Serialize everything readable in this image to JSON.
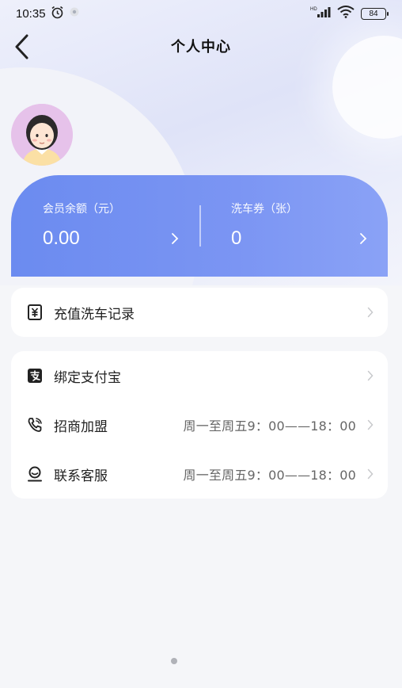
{
  "status_bar": {
    "time": "10:35",
    "battery": "84",
    "network": "HD"
  },
  "header": {
    "title": "个人中心"
  },
  "balance_card": {
    "left_label": "会员余额（元）",
    "left_value": "0.00",
    "right_label": "洗车券（张）",
    "right_value": "0",
    "accent": "#6b8bf0"
  },
  "menu_group_1": [
    {
      "label": "充值洗车记录",
      "value": "",
      "icon": "yuan-receipt-icon"
    }
  ],
  "menu_group_2": [
    {
      "label": "绑定支付宝",
      "value": "",
      "icon": "alipay-icon"
    },
    {
      "label": "招商加盟",
      "value": "周一至周五9：00——18：00",
      "icon": "phone-icon"
    },
    {
      "label": "联系客服",
      "value": "周一至周五9：00——18：00",
      "icon": "customer-service-icon"
    }
  ]
}
